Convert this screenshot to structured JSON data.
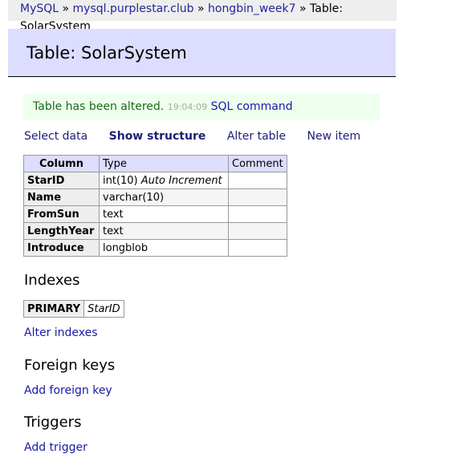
{
  "breadcrumb": {
    "items": [
      "MySQL",
      "mysql.purplestar.club",
      "hongbin_week7"
    ],
    "sep": " » ",
    "current": "Table: SolarSystem"
  },
  "title": "Table: SolarSystem",
  "message": {
    "text": "Table has been altered.",
    "time": "19:04:09",
    "link": "SQL command"
  },
  "menu": {
    "select": "Select data",
    "show": "Show structure",
    "alter": "Alter table",
    "new": "New item"
  },
  "structure": {
    "headers": [
      "Column",
      "Type",
      "Comment"
    ],
    "rows": [
      {
        "column": "StarID",
        "type": "int(10)",
        "extra": "Auto Increment",
        "comment": ""
      },
      {
        "column": "Name",
        "type": "varchar(10)",
        "extra": "",
        "comment": ""
      },
      {
        "column": "FromSun",
        "type": "text",
        "extra": "",
        "comment": ""
      },
      {
        "column": "LengthYear",
        "type": "text",
        "extra": "",
        "comment": ""
      },
      {
        "column": "Introduce",
        "type": "longblob",
        "extra": "",
        "comment": ""
      }
    ]
  },
  "indexes": {
    "heading": "Indexes",
    "type": "PRIMARY",
    "columns": "StarID",
    "alter": "Alter indexes"
  },
  "foreign_keys": {
    "heading": "Foreign keys",
    "add": "Add foreign key"
  },
  "triggers": {
    "heading": "Triggers",
    "add": "Add trigger"
  }
}
